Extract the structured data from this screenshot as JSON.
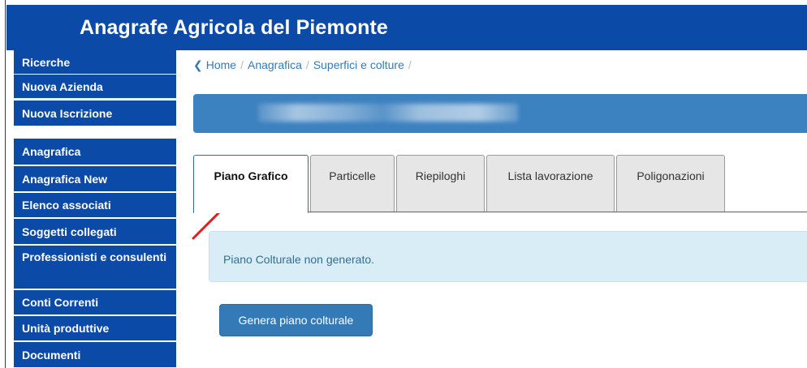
{
  "header": {
    "title": "Anagrafe Agricola del Piemonte"
  },
  "sidebar": {
    "items": [
      {
        "label": "Ricerche"
      },
      {
        "label": "Nuova Azienda"
      },
      {
        "label": "Nuova Iscrizione"
      },
      {
        "label": "Anagrafica"
      },
      {
        "label": "Anagrafica New"
      },
      {
        "label": "Elenco associati"
      },
      {
        "label": "Soggetti collegati"
      },
      {
        "label": "Professionisti e consulenti"
      },
      {
        "label": "Conti Correnti"
      },
      {
        "label": "Unità produttive"
      },
      {
        "label": "Documenti"
      }
    ]
  },
  "breadcrumb": {
    "items": [
      {
        "label": "Home"
      },
      {
        "label": "Anagrafica"
      },
      {
        "label": "Superfici e colture"
      }
    ],
    "separator": "/"
  },
  "tabs": [
    {
      "label": "Piano Grafico",
      "active": true
    },
    {
      "label": "Particelle"
    },
    {
      "label": "Riepiloghi"
    },
    {
      "label": "Lista lavorazione"
    },
    {
      "label": "Poligonazioni"
    }
  ],
  "alert": {
    "message": "Piano Colturale non generato."
  },
  "actions": {
    "generate_label": "Genera piano colturale"
  },
  "colors": {
    "header_bg": "#0b4aa6",
    "sidebar_bg": "#0b4aa6",
    "link": "#337ab7",
    "info_bar": "#3c81c0",
    "alert_bg": "#d9edf7",
    "alert_text": "#31708f",
    "button_bg": "#337ab7",
    "annotation_arrow": "#e02020"
  }
}
